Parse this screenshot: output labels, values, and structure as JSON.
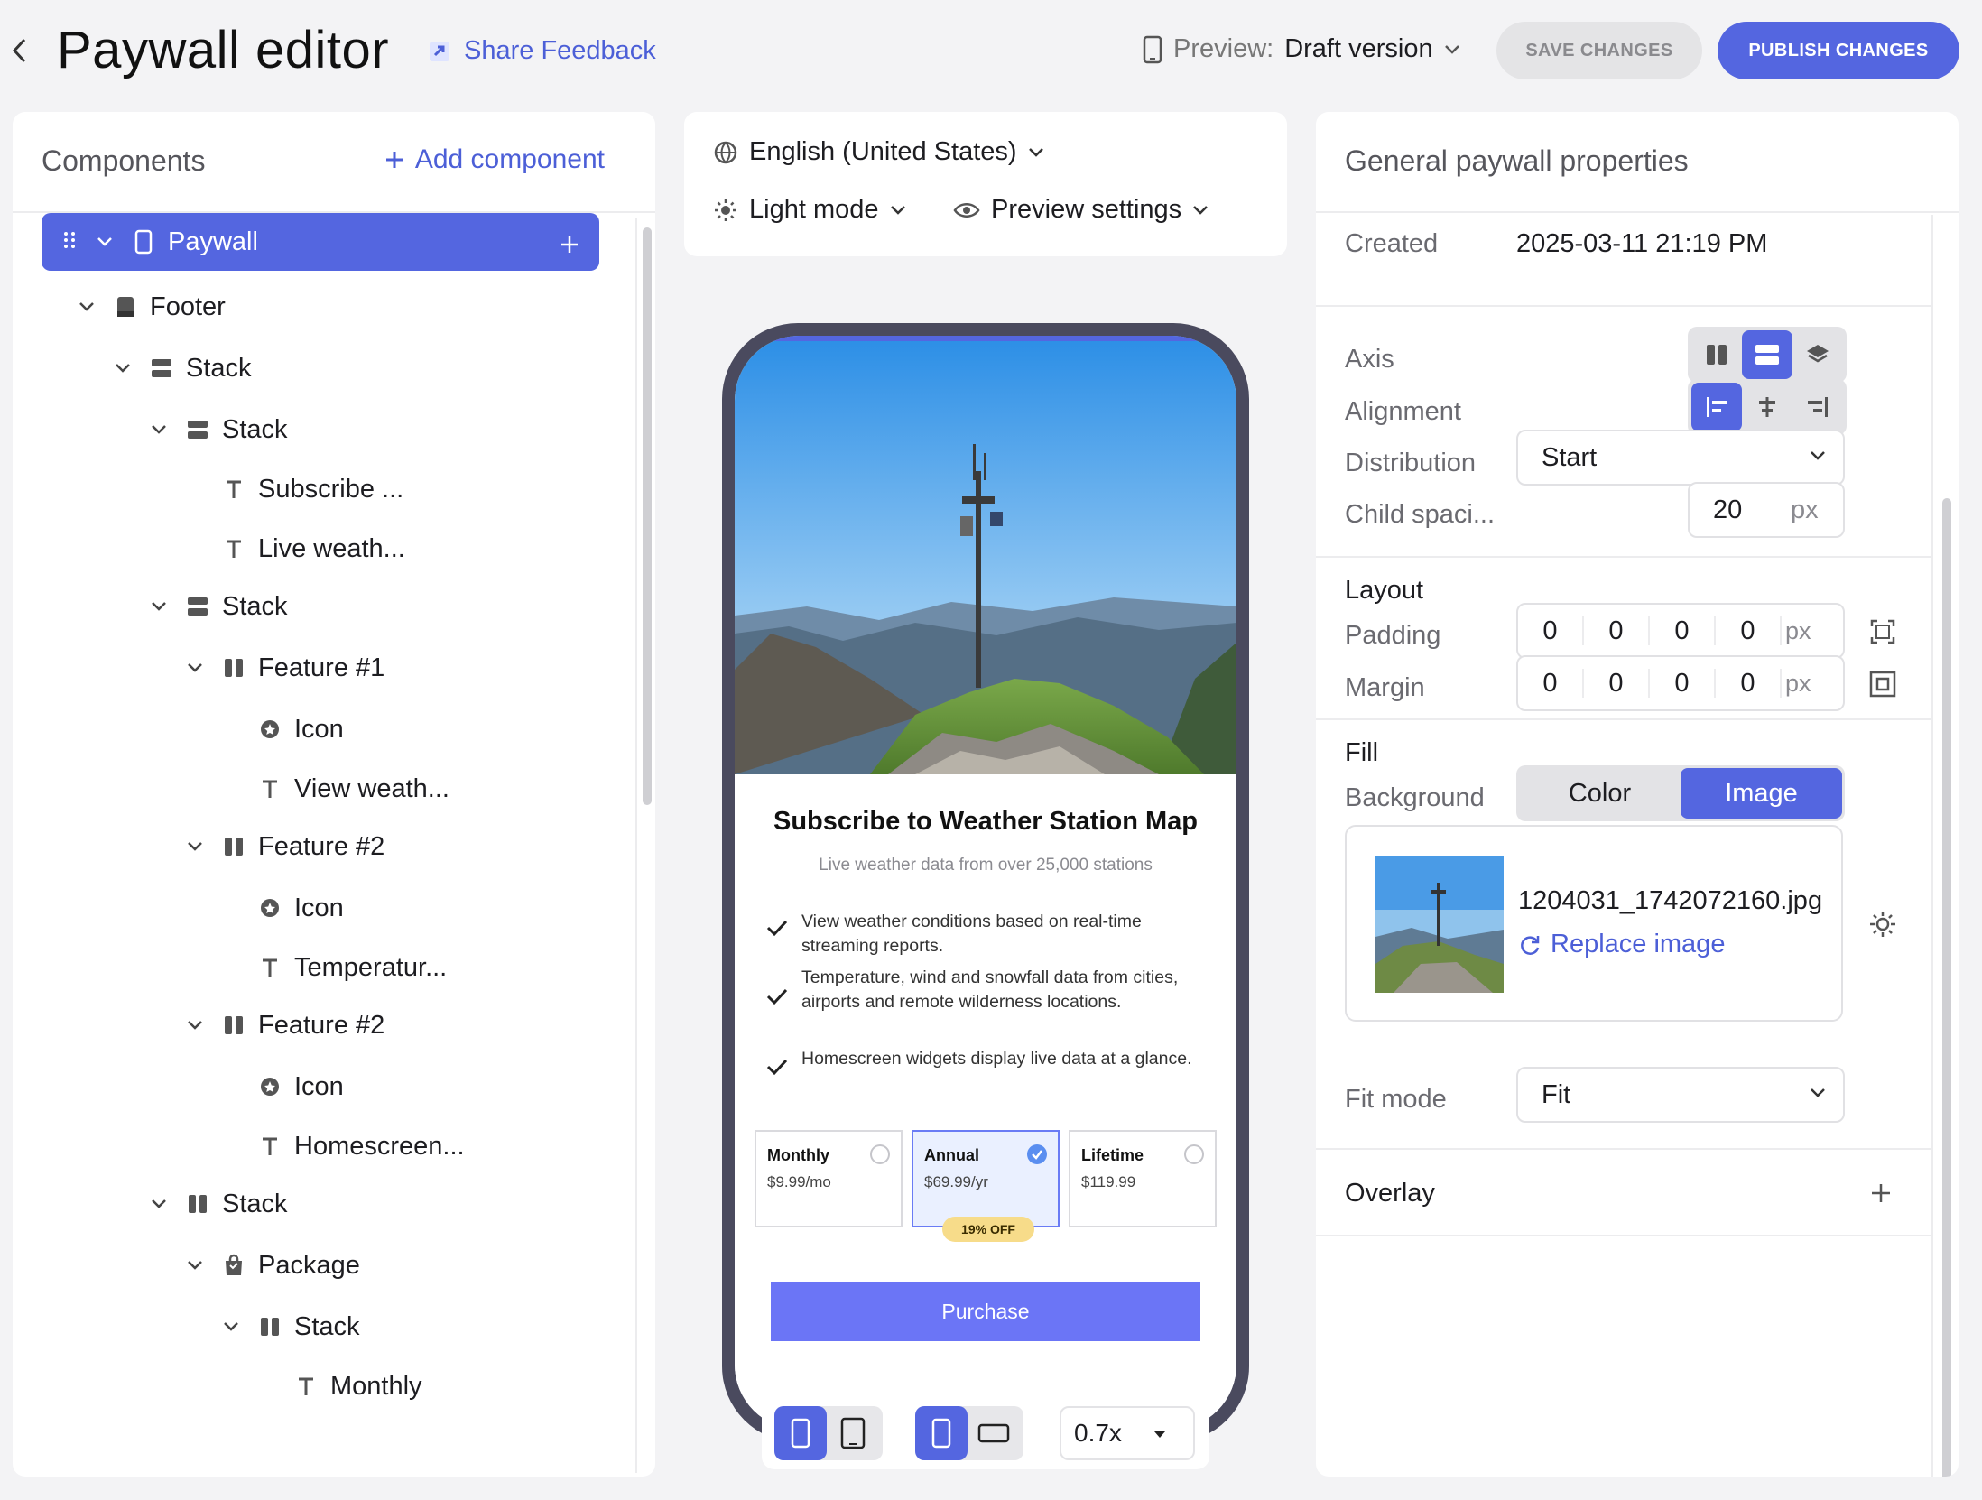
{
  "header": {
    "title": "Paywall editor",
    "share_feedback": "Share Feedback",
    "preview_label": "Preview:",
    "preview_value": "Draft version",
    "save_label": "SAVE CHANGES",
    "publish_label": "PUBLISH CHANGES"
  },
  "components": {
    "title": "Components",
    "add_label": "Add component",
    "tree": [
      {
        "label": "Paywall",
        "level": 0,
        "icon": "phone-icon",
        "expanded": true,
        "selected": true
      },
      {
        "label": "Footer",
        "level": 1,
        "icon": "footer-icon",
        "expanded": true
      },
      {
        "label": "Stack",
        "level": 2,
        "icon": "stack-vertical-icon",
        "expanded": true
      },
      {
        "label": "Stack",
        "level": 3,
        "icon": "stack-vertical-icon",
        "expanded": true
      },
      {
        "label": "Subscribe ...",
        "level": 4,
        "icon": "text-icon"
      },
      {
        "label": "Live weath...",
        "level": 4,
        "icon": "text-icon"
      },
      {
        "label": "Stack",
        "level": 3,
        "icon": "stack-vertical-icon",
        "expanded": true
      },
      {
        "label": "Feature #1",
        "level": 4,
        "icon": "stack-horizontal-icon",
        "expanded": true
      },
      {
        "label": "Icon",
        "level": 5,
        "icon": "icon-component-icon"
      },
      {
        "label": "View weath...",
        "level": 5,
        "icon": "text-icon"
      },
      {
        "label": "Feature #2",
        "level": 4,
        "icon": "stack-horizontal-icon",
        "expanded": true
      },
      {
        "label": "Icon",
        "level": 5,
        "icon": "icon-component-icon"
      },
      {
        "label": "Temperatur...",
        "level": 5,
        "icon": "text-icon"
      },
      {
        "label": "Feature #2",
        "level": 4,
        "icon": "stack-horizontal-icon",
        "expanded": true
      },
      {
        "label": "Icon",
        "level": 5,
        "icon": "icon-component-icon"
      },
      {
        "label": "Homescreen...",
        "level": 5,
        "icon": "text-icon"
      },
      {
        "label": "Stack",
        "level": 3,
        "icon": "stack-horizontal-icon",
        "expanded": true
      },
      {
        "label": "Package",
        "level": 4,
        "icon": "package-icon",
        "expanded": true
      },
      {
        "label": "Stack",
        "level": 5,
        "icon": "stack-horizontal-icon",
        "expanded": true
      },
      {
        "label": "Monthly",
        "level": 6,
        "icon": "text-icon"
      }
    ]
  },
  "preview_controls": {
    "locale": "English (United States)",
    "theme": "Light mode",
    "settings": "Preview settings"
  },
  "paywall_preview": {
    "title": "Subscribe to Weather Station Map",
    "subtitle": "Live weather data from over 25,000 stations",
    "features": [
      "View weather conditions based on real-time streaming reports.",
      "Temperature, wind and snowfall data from cities, airports and remote wilderness locations.",
      "Homescreen widgets display live data at a glance."
    ],
    "packages": [
      {
        "name": "Monthly",
        "price": "$9.99/mo",
        "selected": false
      },
      {
        "name": "Annual",
        "price": "$69.99/yr",
        "selected": true
      },
      {
        "name": "Lifetime",
        "price": "$119.99",
        "selected": false
      }
    ],
    "badge": "19% OFF",
    "purchase_label": "Purchase"
  },
  "device_toolbar": {
    "zoom": "0.7x"
  },
  "properties": {
    "title": "General paywall properties",
    "created_label": "Created",
    "created_value": "2025-03-11 21:19 PM",
    "axis_label": "Axis",
    "alignment_label": "Alignment",
    "distribution_label": "Distribution",
    "distribution_value": "Start",
    "child_spacing_label": "Child spaci...",
    "child_spacing_value": "20",
    "unit": "px",
    "layout_title": "Layout",
    "padding_label": "Padding",
    "padding": [
      "0",
      "0",
      "0",
      "0"
    ],
    "margin_label": "Margin",
    "margin": [
      "0",
      "0",
      "0",
      "0"
    ],
    "fill_title": "Fill",
    "background_label": "Background",
    "background_options": [
      "Color",
      "Image"
    ],
    "background_selected": "Image",
    "image_filename": "1204031_1742072160.jpg",
    "replace_image": "Replace image",
    "fit_mode_label": "Fit mode",
    "fit_mode_value": "Fit",
    "overlay_title": "Overlay"
  },
  "colors": {
    "accent": "#5466e0",
    "purchase_button": "#6b75f6",
    "badge": "#f7dc8a",
    "phone_frame": "#4a4a5e"
  }
}
